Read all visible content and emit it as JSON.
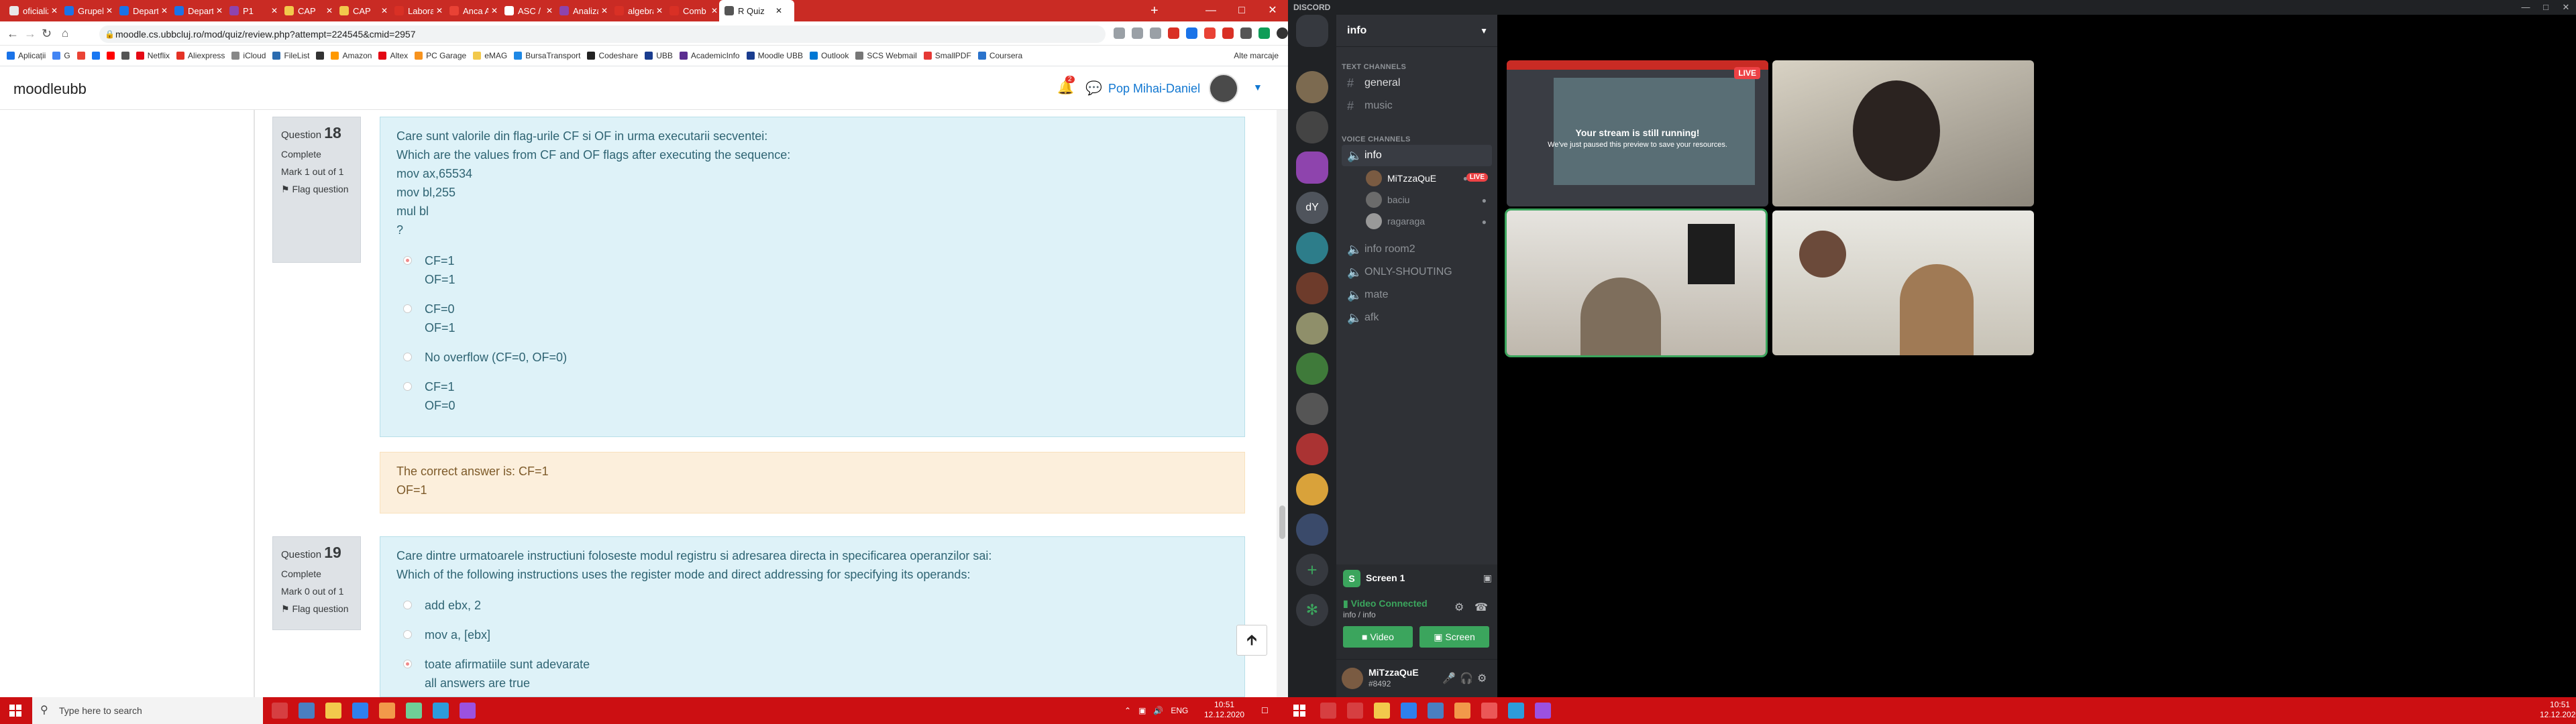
{
  "browser": {
    "tabs": [
      {
        "label": "oficializ"
      },
      {
        "label": "Grupele"
      },
      {
        "label": "Departa"
      },
      {
        "label": "Departa"
      },
      {
        "label": "P1"
      },
      {
        "label": "CAP"
      },
      {
        "label": "CAP"
      },
      {
        "label": "Laborat"
      },
      {
        "label": "Anca Ap"
      },
      {
        "label": "ASC / C"
      },
      {
        "label": "Analiza"
      },
      {
        "label": "algebra"
      },
      {
        "label": "Comb s"
      },
      {
        "label": "R Quiz"
      }
    ],
    "url": "moodle.cs.ubbcluj.ro/mod/quiz/review.php?attempt=224545&cmid=2957",
    "bookmarks": [
      "Aplicații",
      "G",
      "",
      "",
      "",
      "",
      "Netflix",
      "Aliexpress",
      "iCloud",
      "FileList",
      "",
      "Amazon",
      "Altex",
      "PC Garage",
      "eMAG",
      "BursaTransport",
      "Codeshare",
      "UBB",
      "AcademicInfo",
      "Moodle UBB",
      "Outlook",
      "SCS Webmail",
      "SmallPDF",
      "Coursera"
    ],
    "other_bookmarks": "Alte marcaje"
  },
  "moodle": {
    "brand": "moodleubb",
    "notif_count": "2",
    "user_name": "Pop Mihai-Daniel",
    "questions": [
      {
        "label": "Question",
        "number": "18",
        "state": "Complete",
        "mark": "Mark 1 out of 1",
        "flag": "Flag question",
        "text_ro": "Care sunt valorile din flag-urile CF si OF in urma executarii secventei:",
        "text_en": "Which are the values from CF and OF flags after executing the sequence:",
        "code": [
          "mov ax,65534",
          "mov bl,255",
          "mul bl",
          "?"
        ],
        "options": [
          {
            "l1": "CF=1",
            "l2": "OF=1",
            "selected": true
          },
          {
            "l1": "CF=0",
            "l2": "OF=1",
            "selected": false
          },
          {
            "l1": "No overflow (CF=0, OF=0)",
            "l2": "",
            "selected": false
          },
          {
            "l1": "CF=1",
            "l2": "OF=0",
            "selected": false
          }
        ],
        "feedback": [
          "The correct answer is: CF=1",
          "OF=1"
        ]
      },
      {
        "label": "Question",
        "number": "19",
        "state": "Complete",
        "mark": "Mark 0 out of 1",
        "flag": "Flag question",
        "text_ro": "Care dintre urmatoarele instructiuni foloseste modul registru si adresarea directa in specificarea operanzilor sai:",
        "text_en": "Which of the following instructions uses the register mode and direct addressing for specifying its operands:",
        "options": [
          {
            "l1": "add ebx, 2",
            "l2": "",
            "selected": false
          },
          {
            "l1": "mov a, [ebx]",
            "l2": "",
            "selected": false
          },
          {
            "l1": "toate afirmatiile sunt adevarate",
            "l2": "all answers are true",
            "selected": true
          }
        ]
      }
    ]
  },
  "taskbar": {
    "search_placeholder": "Type here to search",
    "lang": "ENG",
    "time": "10:51",
    "date": "12.12.2020"
  },
  "discord": {
    "app_title": "DISCORD",
    "server_name": "info",
    "text_channels_label": "TEXT CHANNELS",
    "voice_channels_label": "VOICE CHANNELS",
    "text_channels": [
      "general",
      "music"
    ],
    "voice_channels": [
      "info",
      "info room2",
      "ONLY-SHOUTING",
      "mate",
      "afk"
    ],
    "voice_users": [
      {
        "name": "MiTzzaQuE",
        "live": "LIVE"
      },
      {
        "name": "baciu"
      },
      {
        "name": "ragaraga"
      }
    ],
    "guild_initials": "dY",
    "screen_label": "Screen 1",
    "screen_initial": "S",
    "voice_status": "Video Connected",
    "voice_location": "info / info",
    "video_btn": "Video",
    "screen_btn": "Screen",
    "user_name": "MiTzzaQuE",
    "user_tag": "#8492",
    "stream": {
      "live": "LIVE",
      "title": "Your stream is still running!",
      "subtitle": "We've just paused this preview to save your resources."
    }
  }
}
